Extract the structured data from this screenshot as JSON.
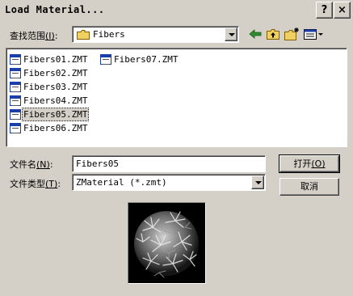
{
  "window": {
    "title": "Load Material...",
    "help_button": "?",
    "close_button": "×"
  },
  "lookin": {
    "label_pre": "查找范围",
    "label_key": "(I)",
    "label_post": ":",
    "value": "Fibers"
  },
  "toolbar": {
    "back": "back-arrow-icon",
    "up": "up-folder-icon",
    "new_folder": "new-folder-icon",
    "view_menu": "view-menu-icon"
  },
  "files": [
    {
      "name": "Fibers01.ZMT",
      "selected": false
    },
    {
      "name": "Fibers02.ZMT",
      "selected": false
    },
    {
      "name": "Fibers03.ZMT",
      "selected": false
    },
    {
      "name": "Fibers04.ZMT",
      "selected": false
    },
    {
      "name": "Fibers05.ZMT",
      "selected": true
    },
    {
      "name": "Fibers06.ZMT",
      "selected": false
    },
    {
      "name": "Fibers07.ZMT",
      "selected": false
    }
  ],
  "filename": {
    "label_pre": "文件名",
    "label_key": "(N)",
    "label_post": ":",
    "value": "Fibers05"
  },
  "filetype": {
    "label_pre": "文件类型",
    "label_key": "(T)",
    "label_post": ":",
    "value": "ZMaterial (*.zmt)"
  },
  "buttons": {
    "open_pre": "打开",
    "open_key": "(O)",
    "cancel": "取消"
  },
  "colors": {
    "dialog_bg": "#d4d0c8",
    "folder_yellow": "#f0d060",
    "arrow_green": "#2e8b2e",
    "file_icon_blue": "#1b3fa8"
  }
}
